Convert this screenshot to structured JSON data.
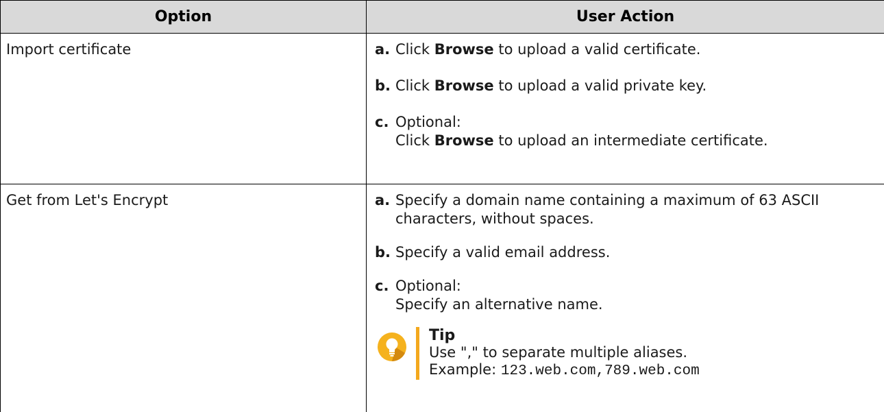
{
  "table": {
    "headers": [
      "Option",
      "User Action"
    ],
    "rows": [
      {
        "option": "Import certificate",
        "steps": [
          {
            "letter": "a.",
            "pre": "Click ",
            "bold": "Browse",
            "post": " to upload a valid certificate."
          },
          {
            "letter": "b.",
            "pre": "Click ",
            "bold": "Browse",
            "post": " to upload a valid private key."
          },
          {
            "letter": "c.",
            "line1": "Optional:",
            "pre": "Click ",
            "bold": "Browse",
            "post": " to upload an intermediate certificate."
          }
        ]
      },
      {
        "option": "Get from Let's Encrypt",
        "steps": [
          {
            "letter": "a.",
            "text": "Specify a domain name containing a maximum of 63 ASCII characters, without spaces."
          },
          {
            "letter": "b.",
            "text": "Specify a valid email address."
          },
          {
            "letter": "c.",
            "line1": "Optional:",
            "line2": "Specify an alternative name."
          }
        ],
        "tip": {
          "icon": "lightbulb-icon",
          "title": "Tip",
          "line1": "Use \",\" to separate multiple aliases.",
          "example_label": "Example: ",
          "example_code": "123.web.com,789.web.com"
        }
      }
    ]
  },
  "colors": {
    "header_bg": "#d9d9d9",
    "tip_accent": "#f4a81d",
    "tip_icon_bg": "#f5b21e"
  }
}
